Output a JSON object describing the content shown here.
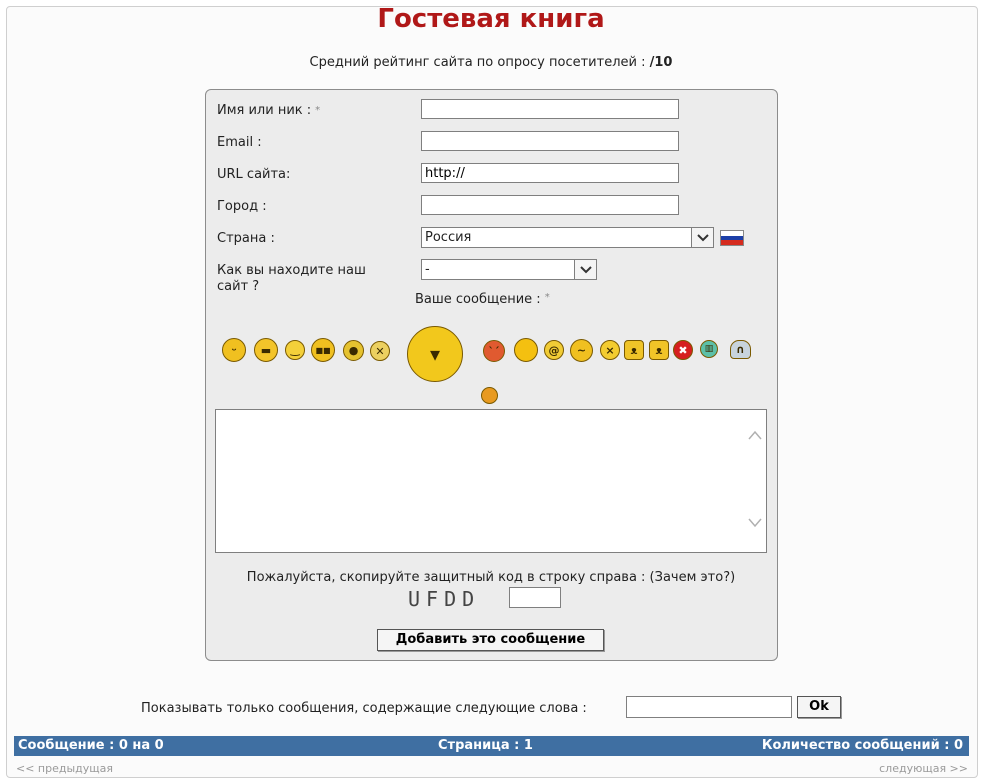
{
  "page": {
    "title": "Гостевая книга",
    "rating_label": "Средний рейтинг сайта по опросу посетителей :",
    "rating_value": "/10"
  },
  "form": {
    "name_label": "Имя или ник :",
    "email_label": "Email :",
    "url_label": "URL сайта:",
    "url_value": "http://",
    "city_label": "Город :",
    "country_label": "Страна :",
    "country_value": "Россия",
    "found_label_line1": "Как вы находите наш",
    "found_label_line2": "сайт ?",
    "found_value": "-",
    "required_mark": "*",
    "message_label": "Ваше сообщение :",
    "captcha_prompt": "Пожалуйста, скопируйте защитный код в строку справа : (Зачем это?)",
    "captcha_code": "UFDD",
    "submit_label": "Добавить это сообщение"
  },
  "smileys": [
    {
      "name": "smiley-grin-icon",
      "glyph": "ᵕ"
    },
    {
      "name": "smiley-teeth-icon",
      "glyph": "▬"
    },
    {
      "name": "smiley-smile-icon",
      "glyph": "‿"
    },
    {
      "name": "smiley-cool-icon",
      "glyph": "■■"
    },
    {
      "name": "smiley-cyclops-icon",
      "glyph": "●"
    },
    {
      "name": "smiley-dizzy-icon",
      "glyph": "✕"
    },
    {
      "name": "smiley-big-evil-icon",
      "glyph": "▾"
    },
    {
      "name": "smiley-angry-icon",
      "glyph": "`´"
    },
    {
      "name": "smiley-blank-icon",
      "glyph": ""
    },
    {
      "name": "smiley-confused-icon",
      "glyph": "@"
    },
    {
      "name": "smiley-wink-icon",
      "glyph": "~"
    },
    {
      "name": "smiley-sad-icon",
      "glyph": "×"
    },
    {
      "name": "smiley-cat-icon",
      "glyph": "ᴥ"
    },
    {
      "name": "smiley-devil-icon",
      "glyph": "ᴥ"
    },
    {
      "name": "smiley-mad-red-icon",
      "glyph": "✖"
    },
    {
      "name": "smiley-green-skull-icon",
      "glyph": "▥"
    },
    {
      "name": "smiley-crying-icon",
      "glyph": "∩"
    },
    {
      "name": "smiley-small-orange-icon",
      "glyph": ""
    }
  ],
  "filter": {
    "label": "Показывать только сообщения, содержащие следующие слова :",
    "button_label": "Ok"
  },
  "status_bar": {
    "messages": "Сообщение : 0 на 0",
    "page": "Страница : 1",
    "count": "Количество сообщений : 0"
  },
  "nav": {
    "prev": "<< предыдущая",
    "next": "следующая >>"
  },
  "colors": {
    "title": "#b01818",
    "status_bar": "#3f6fa2"
  }
}
